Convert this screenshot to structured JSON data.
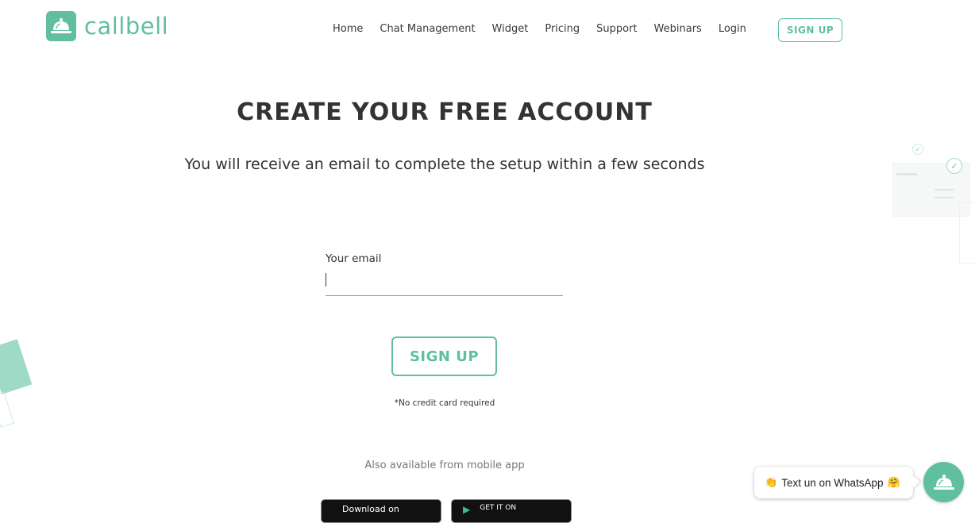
{
  "header": {
    "logo_text": "callbell",
    "nav": [
      "Home",
      "Chat Management",
      "Widget",
      "Pricing",
      "Support",
      "Webinars",
      "Login"
    ],
    "signup_label": "SIGN UP"
  },
  "main": {
    "title": "CREATE YOUR FREE ACCOUNT",
    "subtitle": "You will receive an email to complete the setup within a few seconds",
    "email_label": "Your email",
    "email_value": "",
    "signup_button": "SIGN UP",
    "no_credit_card": "*No credit card required",
    "mobile_note": "Also available from mobile app",
    "app_store_label": "Download on",
    "google_play_label": "GET IT ON"
  },
  "whatsapp_widget": {
    "text": "Text un on WhatsApp",
    "left_emoji": "👏",
    "right_emoji": "🤗"
  },
  "colors": {
    "accent": "#5fbf9f",
    "text": "#333333"
  },
  "icons": [
    "bell-icon",
    "check-icon",
    "apple-icon",
    "play-icon"
  ]
}
